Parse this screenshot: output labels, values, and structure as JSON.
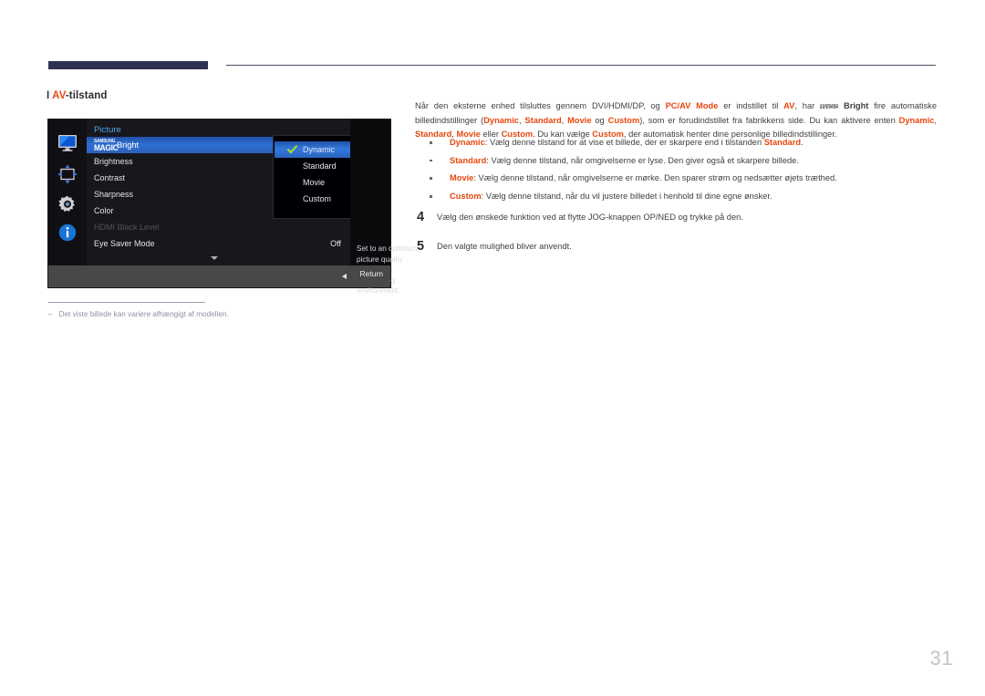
{
  "page": {
    "number": "31",
    "heading": {
      "marker": "I",
      "accent": "AV",
      "rest": "-tilstand"
    },
    "footnote": {
      "dash": "‒",
      "text": "Det viste billede kan variere afhængigt af modellen."
    }
  },
  "osd": {
    "title": "Picture",
    "description": "Set to an optimum\npicture quality\nsuitable for\nthe working\nenvironment.",
    "return_label": "Return",
    "icons": [
      {
        "name": "monitor-icon",
        "label": "Picture"
      },
      {
        "name": "screen-adjust-icon",
        "label": "Screen"
      },
      {
        "name": "gear-icon",
        "label": "System"
      },
      {
        "name": "info-icon",
        "label": "Information"
      }
    ],
    "menu_items": [
      {
        "label": "MAGICBright",
        "value": "",
        "selected": true,
        "disabled": false,
        "is_magic": true,
        "magic_top": "SAMSUNG",
        "magic_mid": "MAGIC",
        "magic_suffix": "Bright"
      },
      {
        "label": "Brightness",
        "value": "",
        "selected": false,
        "disabled": false,
        "is_magic": false
      },
      {
        "label": "Contrast",
        "value": "",
        "selected": false,
        "disabled": false,
        "is_magic": false
      },
      {
        "label": "Sharpness",
        "value": "",
        "selected": false,
        "disabled": false,
        "is_magic": false
      },
      {
        "label": "Color",
        "value": "",
        "selected": false,
        "disabled": false,
        "is_magic": false
      },
      {
        "label": "HDMI Black Level",
        "value": "",
        "selected": false,
        "disabled": true,
        "is_magic": false
      },
      {
        "label": "Eye Saver Mode",
        "value": "Off",
        "selected": false,
        "disabled": false,
        "is_magic": false
      }
    ],
    "dropdown": [
      {
        "label": "Dynamic",
        "selected": true,
        "checked": true
      },
      {
        "label": "Standard",
        "selected": false,
        "checked": false
      },
      {
        "label": "Movie",
        "selected": false,
        "checked": false
      },
      {
        "label": "Custom",
        "selected": false,
        "checked": false
      }
    ]
  },
  "body": {
    "intro": {
      "p1": "Når den eksterne enhed tilsluttes gennem DVI/HDMI/DP, og ",
      "b1": "PC/AV Mode",
      "p2": " er indstillet til ",
      "b2": "AV",
      "p3": ", har ",
      "magic_top": "SAMSUNG",
      "magic_mid": "MAGIC",
      "b3": "Bright",
      "p4": " fire automatiske billedindstillinger (",
      "b4": "Dynamic",
      "p5": ", ",
      "b5": "Standard",
      "p6": ", ",
      "b6": "Movie",
      "p7": " og ",
      "b7": "Custom",
      "p8": "), som er forudindstillet fra fabrikkens side. Du kan aktivere enten ",
      "b8": "Dynamic",
      "p9": ", ",
      "b9": "Standard",
      "p10": ", ",
      "b10": "Movie",
      "p11": " eller ",
      "b11": "Custom",
      "p12": ". Du kan vælge ",
      "b12": "Custom",
      "p13": ", der automatisk henter dine personlige billedindstillinger."
    },
    "bullets": [
      {
        "term": "Dynamic",
        "sep": ": ",
        "text_before": "Vælg denne tilstand for at vise et billede, der er skarpere end i tilstanden ",
        "term2": "Standard",
        "text_after": "."
      },
      {
        "term": "Standard",
        "sep": ": ",
        "text_before": "Vælg denne tilstand, når omgivelserne er lyse. Den giver også et skarpere billede.",
        "term2": "",
        "text_after": ""
      },
      {
        "term": "Movie",
        "sep": ": ",
        "text_before": "Vælg denne tilstand, når omgivelserne er mørke. Den sparer strøm og nedsætter øjets træthed.",
        "term2": "",
        "text_after": ""
      },
      {
        "term": "Custom",
        "sep": ": ",
        "text_before": "Vælg denne tilstand, når du vil justere billedet i henhold til dine egne ønsker.",
        "term2": "",
        "text_after": ""
      }
    ],
    "steps": [
      {
        "num": "4",
        "text": "Vælg den ønskede funktion ved at flytte JOG-knappen OP/NED og trykke på den."
      },
      {
        "num": "5",
        "text": "Den valgte mulighed bliver anvendt."
      }
    ]
  },
  "colors": {
    "accent_red": "#e8470f",
    "navy": "#2e3152",
    "osd_blue": "#2f6fd0",
    "osd_title_blue": "#4fa6e8",
    "check_green": "#b8e020"
  }
}
